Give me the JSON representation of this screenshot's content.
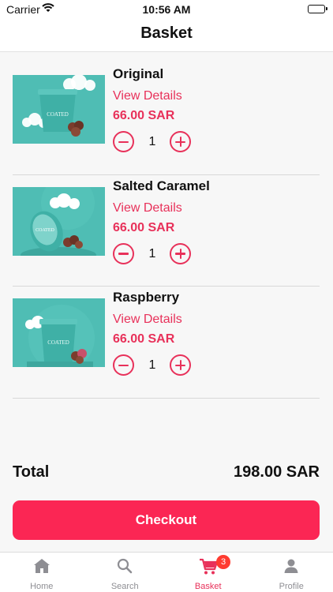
{
  "status_bar": {
    "carrier": "Carrier",
    "time": "10:56 AM"
  },
  "header": {
    "title": "Basket"
  },
  "items": [
    {
      "name": "Original",
      "details_label": "View Details",
      "price": "66.00 SAR",
      "quantity": "1",
      "image_brand": "COATED"
    },
    {
      "name": "Salted Caramel",
      "details_label": "View Details",
      "price": "66.00 SAR",
      "quantity": "1",
      "image_brand": "COATED"
    },
    {
      "name": "Raspberry",
      "details_label": "View Details",
      "price": "66.00 SAR",
      "quantity": "1",
      "image_brand": "COATED"
    }
  ],
  "summary": {
    "total_label": "Total",
    "total_value": "198.00 SAR"
  },
  "checkout_label": "Checkout",
  "tabs": [
    {
      "label": "Home",
      "icon": "home-icon"
    },
    {
      "label": "Search",
      "icon": "search-icon"
    },
    {
      "label": "Basket",
      "icon": "cart-icon",
      "badge": "3",
      "active": true
    },
    {
      "label": "Profile",
      "icon": "person-icon"
    }
  ],
  "colors": {
    "accent": "#e8315a",
    "button": "#fb2654",
    "teal": "#4fbdb4",
    "badge": "#ff3b30"
  }
}
